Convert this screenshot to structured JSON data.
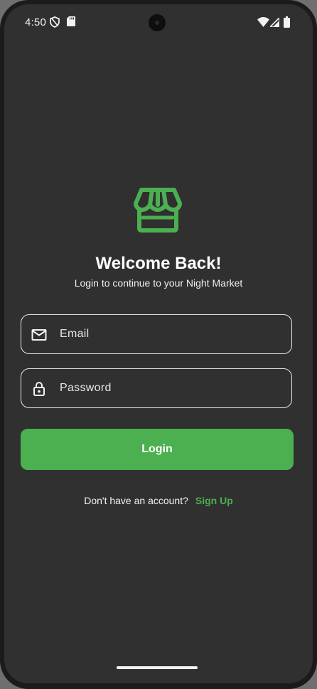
{
  "status_bar": {
    "time": "4:50",
    "icons": [
      "shield-icon",
      "sd-card-icon",
      "wifi-icon",
      "signal-icon",
      "battery-icon"
    ]
  },
  "brand": {
    "logo_icon": "storefront-icon",
    "accent_color": "#4caf50"
  },
  "header": {
    "title": "Welcome Back!",
    "subtitle": "Login to continue to your Night Market"
  },
  "form": {
    "email": {
      "label": "Email",
      "icon": "mail-icon",
      "value": ""
    },
    "password": {
      "label": "Password",
      "icon": "lock-icon",
      "value": ""
    },
    "login_label": "Login"
  },
  "footer": {
    "question": "Don't have an account?",
    "signup_label": "Sign Up"
  }
}
